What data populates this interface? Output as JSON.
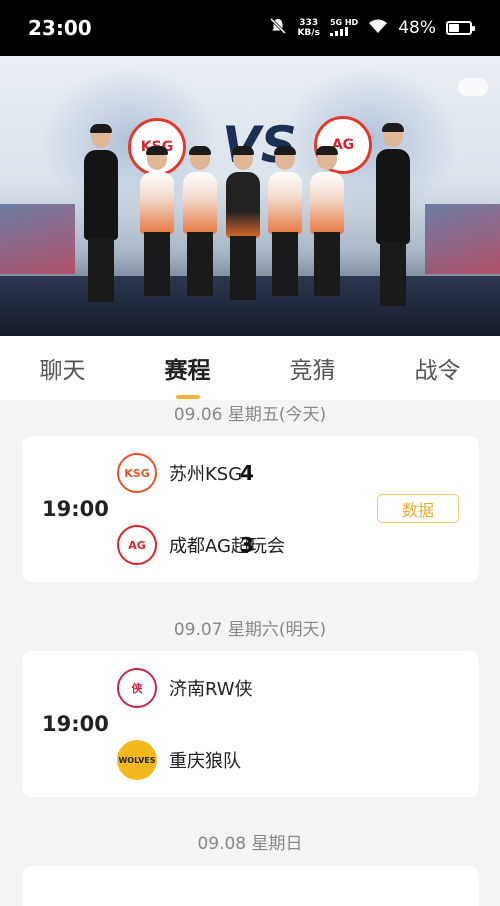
{
  "status_bar": {
    "time": "23:00",
    "net_speed_value": "333",
    "net_speed_unit": "KB/s",
    "network_type": "5G HD",
    "battery_text": "48%",
    "battery_level": 0.48
  },
  "video": {
    "vs_text": "VS",
    "left_emblem_text": "KSG",
    "right_emblem_text": "AG"
  },
  "tabs": [
    {
      "label": "聊天"
    },
    {
      "label": "赛程",
      "active": true
    },
    {
      "label": "竞猜"
    },
    {
      "label": "战令"
    }
  ],
  "schedule": [
    {
      "date": "09.06 星期五(今天)",
      "time": "19:00",
      "team1": {
        "name": "苏州KSG",
        "logo_text": "KSG",
        "score": "4",
        "logo_color": "#e2552b"
      },
      "team2": {
        "name": "成都AG超玩会",
        "logo_text": "AG",
        "score": "3",
        "logo_color": "#d8262b"
      },
      "action_label": "数据"
    },
    {
      "date": "09.07 星期六(明天)",
      "time": "19:00",
      "team1": {
        "name": "济南RW侠",
        "logo_text": "侠",
        "logo_color": "#c8284a"
      },
      "team2": {
        "name": "重庆狼队",
        "logo_text": "WOLVES",
        "logo_color": "#f2b81c"
      }
    },
    {
      "date": "09.08 星期日"
    }
  ]
}
